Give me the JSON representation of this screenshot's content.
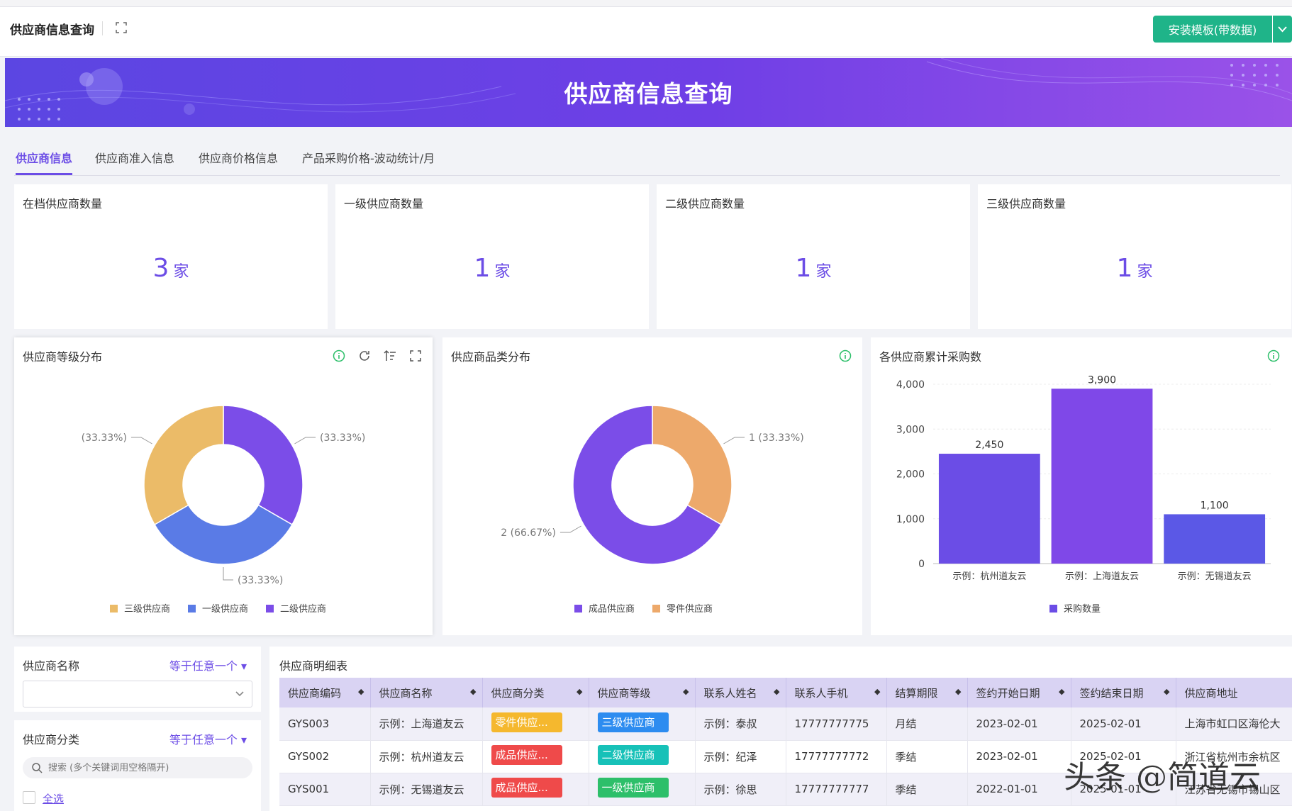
{
  "header": {
    "app_title": "供应商信息查询",
    "install_button": "安装模板(带数据)"
  },
  "banner": {
    "title": "供应商信息查询"
  },
  "tabs": [
    {
      "label": "供应商信息"
    },
    {
      "label": "供应商准入信息"
    },
    {
      "label": "供应商价格信息"
    },
    {
      "label": "产品采购价格-波动统计/月"
    }
  ],
  "kpis": [
    {
      "label": "在档供应商数量",
      "value": "3",
      "unit": "家"
    },
    {
      "label": "一级供应商数量",
      "value": "1",
      "unit": "家"
    },
    {
      "label": "二级供应商数量",
      "value": "1",
      "unit": "家"
    },
    {
      "label": "三级供应商数量",
      "value": "1",
      "unit": "家"
    }
  ],
  "cards": {
    "grade": {
      "title": "供应商等级分布"
    },
    "category": {
      "title": "供应商品类分布"
    },
    "purchase": {
      "title": "各供应商累计采购数"
    }
  },
  "chart_data": [
    {
      "type": "pie",
      "title": "供应商等级分布",
      "donut": true,
      "slices": [
        {
          "name": "二级供应商",
          "value": 1,
          "label": "(33.33%)",
          "color": "#7b4de8"
        },
        {
          "name": "一级供应商",
          "value": 1,
          "label": "(33.33%)",
          "color": "#5a7be6"
        },
        {
          "name": "三级供应商",
          "value": 1,
          "label": "(33.33%)",
          "color": "#ebbb68"
        }
      ],
      "legend": [
        "三级供应商",
        "一级供应商",
        "二级供应商"
      ],
      "legend_colors": [
        "#ebbb68",
        "#5a7be6",
        "#7b4de8"
      ],
      "legend_position": "bottom"
    },
    {
      "type": "pie",
      "title": "供应商品类分布",
      "donut": true,
      "slices": [
        {
          "name": "零件供应商",
          "value": 1,
          "label": "1 (33.33%)",
          "color": "#eda96b"
        },
        {
          "name": "成品供应商",
          "value": 2,
          "label": "2 (66.67%)",
          "color": "#7b4de8"
        }
      ],
      "legend": [
        "成品供应商",
        "零件供应商"
      ],
      "legend_colors": [
        "#7b4de8",
        "#eda96b"
      ],
      "legend_position": "bottom"
    },
    {
      "type": "bar",
      "title": "各供应商累计采购数",
      "categories": [
        "示例：杭州道友云",
        "示例：上海道友云",
        "示例：无锡道友云"
      ],
      "values": [
        2450,
        3900,
        1100
      ],
      "value_labels": [
        "2,450",
        "3,900",
        "1,100"
      ],
      "colors": [
        "#6b4de6",
        "#7f48e8",
        "#5b58e6"
      ],
      "yticks": [
        "0",
        "1,000",
        "2,000",
        "3,000",
        "4,000"
      ],
      "ylim": [
        0,
        4000
      ],
      "series_name": "采购数量",
      "legend_color": "#6b4de6",
      "legend_position": "bottom",
      "grid": true
    }
  ],
  "filters": {
    "name": {
      "label": "供应商名称",
      "mode": "等于任意一个"
    },
    "category": {
      "label": "供应商分类",
      "mode": "等于任意一个",
      "search_placeholder": "搜索 (多个关键词用空格隔开)",
      "select_all": "全选"
    }
  },
  "table": {
    "title": "供应商明细表",
    "columns": [
      "供应商编码",
      "供应商名称",
      "供应商分类",
      "供应商等级",
      "联系人姓名",
      "联系人手机",
      "结算期限",
      "签约开始日期",
      "签约结束日期",
      "供应商地址"
    ],
    "rows": [
      {
        "code": "GYS003",
        "name": "示例：上海道友云",
        "category": "零件供应...",
        "category_color": "#f5b82e",
        "grade": "三级供应商",
        "grade_color": "#2d8cf0",
        "contact": "示例：泰叔",
        "phone": "17777777775",
        "term": "月结",
        "start": "2023-02-01",
        "end": "2025-02-01",
        "address": "上海市虹口区海伦大"
      },
      {
        "code": "GYS002",
        "name": "示例：杭州道友云",
        "category": "成品供应...",
        "category_color": "#ef4a4a",
        "grade": "二级供应商",
        "grade_color": "#17c1b8",
        "contact": "示例：纪泽",
        "phone": "17777777772",
        "term": "季结",
        "start": "2023-02-01",
        "end": "2025-02-01",
        "address": "浙江省杭州市余杭区"
      },
      {
        "code": "GYS001",
        "name": "示例：无锡道友云",
        "category": "成品供应...",
        "category_color": "#ef4a4a",
        "grade": "一级供应商",
        "grade_color": "#2dbf6a",
        "contact": "示例：徐思",
        "phone": "17777777777",
        "term": "季结",
        "start": "2022-01-01",
        "end": "2025-01-01",
        "address": "江苏省无锡市锡山区"
      }
    ]
  },
  "watermark": "头条 @简道云"
}
